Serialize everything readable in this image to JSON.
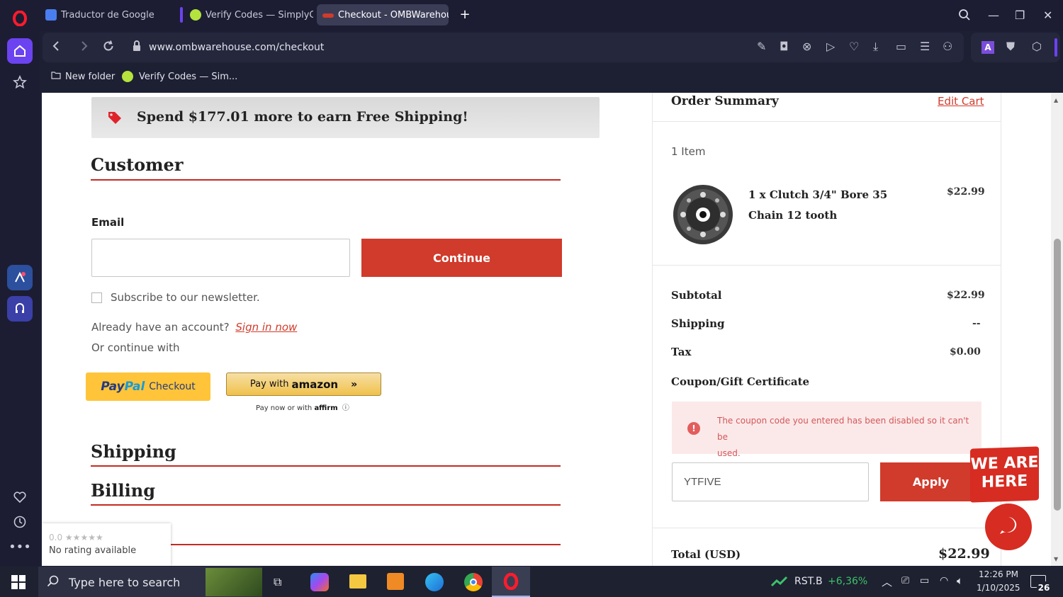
{
  "browser": {
    "tabs": [
      {
        "label": "Traductor de Google"
      },
      {
        "label": "Verify Codes — SimplyCodes"
      },
      {
        "label": "Checkout - OMBWarehouse"
      }
    ],
    "url": "www.ombwarehouse.com/checkout",
    "bookmarks": [
      {
        "label": "New folder"
      },
      {
        "label": "Verify Codes — Sim..."
      }
    ]
  },
  "shipping_banner": {
    "text": "Spend $177.01 more to earn Free Shipping!"
  },
  "customer": {
    "heading": "Customer",
    "email_label": "Email",
    "email_value": "",
    "continue_label": "Continue",
    "newsletter_label": "Subscribe to our newsletter.",
    "account_prompt": "Already have an account?",
    "sign_in_label": "Sign in now",
    "or_continue": "Or continue with",
    "paypal_brand_1": "Pay",
    "paypal_brand_2": "Pal",
    "paypal_suffix": "Checkout",
    "amazon_prefix": "Pay with",
    "amazon_brand": "amazon",
    "affirm_prefix": "Pay now or with",
    "affirm_brand": "affirm"
  },
  "sections": {
    "shipping": "Shipping",
    "billing": "Billing"
  },
  "rating_widget": {
    "score": "0.0",
    "stars": "★★★★★",
    "text": "No rating available"
  },
  "order_summary": {
    "title": "Order Summary",
    "edit_cart": "Edit Cart",
    "item_count": "1 Item",
    "item": {
      "name_line1": "1 x Clutch 3/4\" Bore 35",
      "name_line2": "Chain 12 tooth",
      "price": "$22.99"
    },
    "subtotal_label": "Subtotal",
    "subtotal_value": "$22.99",
    "shipping_label": "Shipping",
    "shipping_value": "--",
    "tax_label": "Tax",
    "tax_value": "$0.00",
    "coupon_label": "Coupon/Gift Certificate",
    "coupon_error_line1": "The coupon code you entered has been disabled so it can't be",
    "coupon_error_line2": "used.",
    "coupon_value": "YTFIVE",
    "apply_label": "Apply",
    "total_label": "Total (USD)",
    "total_value": "$22.99"
  },
  "chat_badge": {
    "line1": "WE ARE",
    "line2": "HERE"
  },
  "taskbar": {
    "search_placeholder": "Type here to search",
    "stock_symbol": "RST.B",
    "stock_change": "+6,36%",
    "time": "12:26 PM",
    "date": "1/10/2025",
    "notification_count": "26"
  },
  "colors": {
    "accent_red": "#d03b2c",
    "line_red": "#c42b22",
    "opera_red": "#ff1b2d",
    "browser_dark": "#1c1d33"
  }
}
